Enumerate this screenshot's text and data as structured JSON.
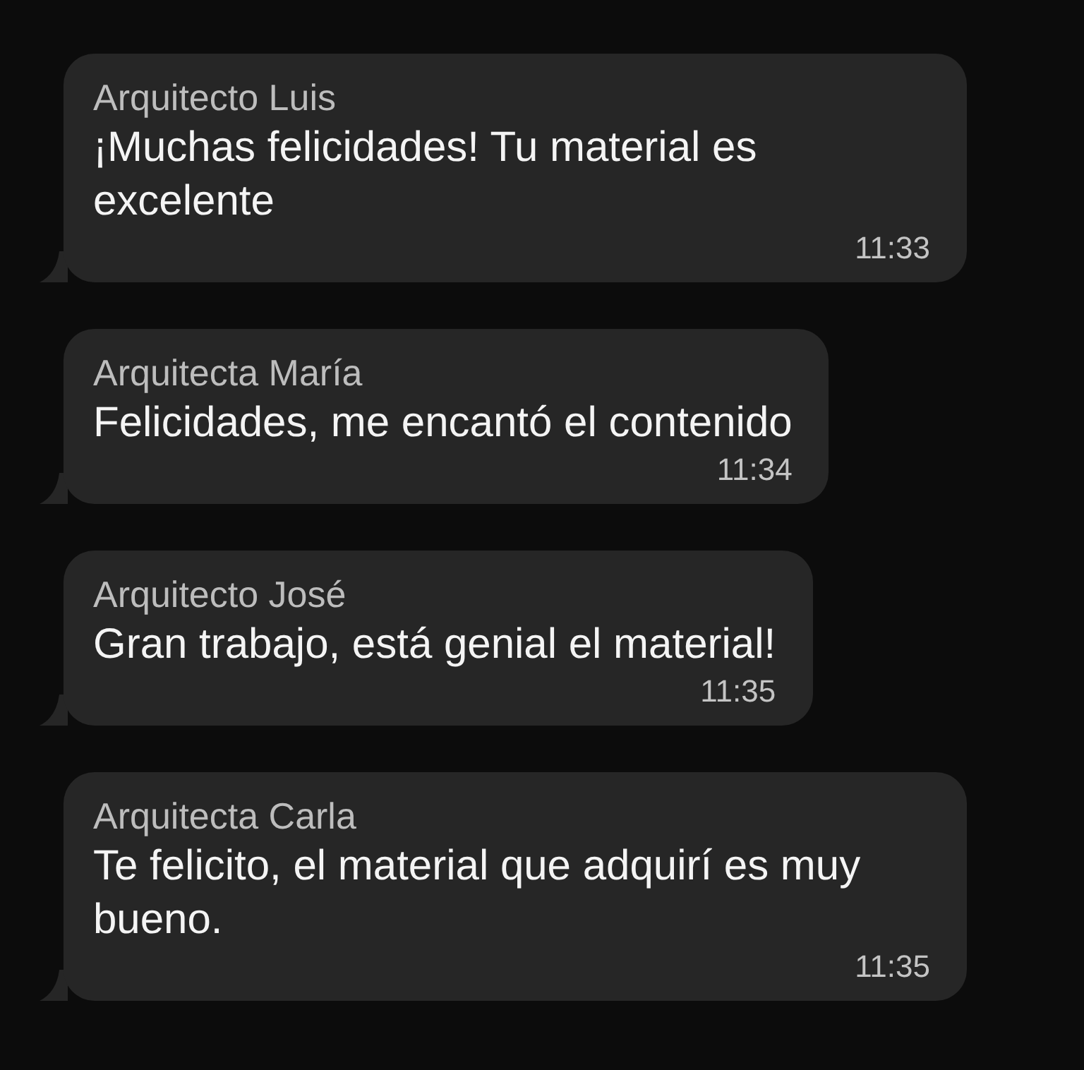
{
  "messages": [
    {
      "sender": "Arquitecto Luis",
      "text": "¡Muchas felicidades! Tu material es excelente",
      "time": "11:33"
    },
    {
      "sender": "Arquitecta María",
      "text": "Felicidades, me encantó el contenido",
      "time": "11:34"
    },
    {
      "sender": "Arquitecto José",
      "text": "Gran trabajo, está genial el material!",
      "time": "11:35"
    },
    {
      "sender": "Arquitecta Carla",
      "text": "Te felicito, el material que adquirí es muy bueno.",
      "time": "11:35"
    }
  ]
}
